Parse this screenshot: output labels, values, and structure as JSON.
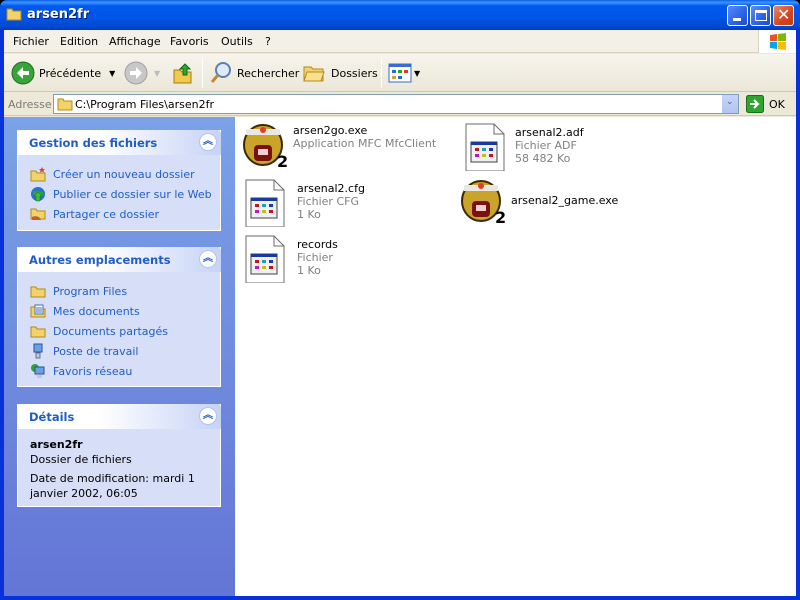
{
  "window": {
    "title": "arsen2fr"
  },
  "menubar": {
    "items": [
      {
        "label": "Fichier",
        "accel": "F"
      },
      {
        "label": "Edition",
        "accel": "E"
      },
      {
        "label": "Affichage",
        "accel": "h"
      },
      {
        "label": "Favoris",
        "accel": "v"
      },
      {
        "label": "Outils",
        "accel": "O"
      },
      {
        "label": "?",
        "accel": "?"
      }
    ]
  },
  "toolbar": {
    "back_label": "Précédente",
    "search_label": "Rechercher",
    "folders_label": "Dossiers"
  },
  "address": {
    "label": "Adresse",
    "value": "C:\\Program Files\\arsen2fr",
    "go_label": "OK"
  },
  "taskpane": {
    "file_tasks": {
      "title": "Gestion des fichiers",
      "items": [
        {
          "label": "Créer un nouveau dossier",
          "icon": "new-folder-icon"
        },
        {
          "label": "Publier ce dossier sur le Web",
          "icon": "publish-web-icon"
        },
        {
          "label": "Partager ce dossier",
          "icon": "share-folder-icon"
        }
      ]
    },
    "other_places": {
      "title": "Autres emplacements",
      "items": [
        {
          "label": "Program Files",
          "icon": "folder-icon"
        },
        {
          "label": "Mes documents",
          "icon": "my-documents-icon"
        },
        {
          "label": "Documents partagés",
          "icon": "folder-icon"
        },
        {
          "label": "Poste de travail",
          "icon": "my-computer-icon"
        },
        {
          "label": "Favoris réseau",
          "icon": "network-places-icon"
        }
      ]
    },
    "details": {
      "title": "Détails",
      "name": "arsen2fr",
      "type": "Dossier de fichiers",
      "modified": "Date de modification: mardi 1 janvier 2002, 06:05"
    }
  },
  "files": [
    {
      "name": "arsen2go.exe",
      "type": "Application MFC MfcClient",
      "size": "",
      "icon": "arsenal-app-icon"
    },
    {
      "name": "arsenal2.adf",
      "type": "Fichier ADF",
      "size": "58 482 Ko",
      "icon": "generic-file-icon"
    },
    {
      "name": "arsenal2.cfg",
      "type": "Fichier CFG",
      "size": "1 Ko",
      "icon": "generic-file-icon"
    },
    {
      "name": "arsenal2_game.exe",
      "type": "",
      "size": "",
      "icon": "arsenal-app-icon"
    },
    {
      "name": "records",
      "type": "Fichier",
      "size": "1 Ko",
      "icon": "generic-file-icon"
    }
  ]
}
